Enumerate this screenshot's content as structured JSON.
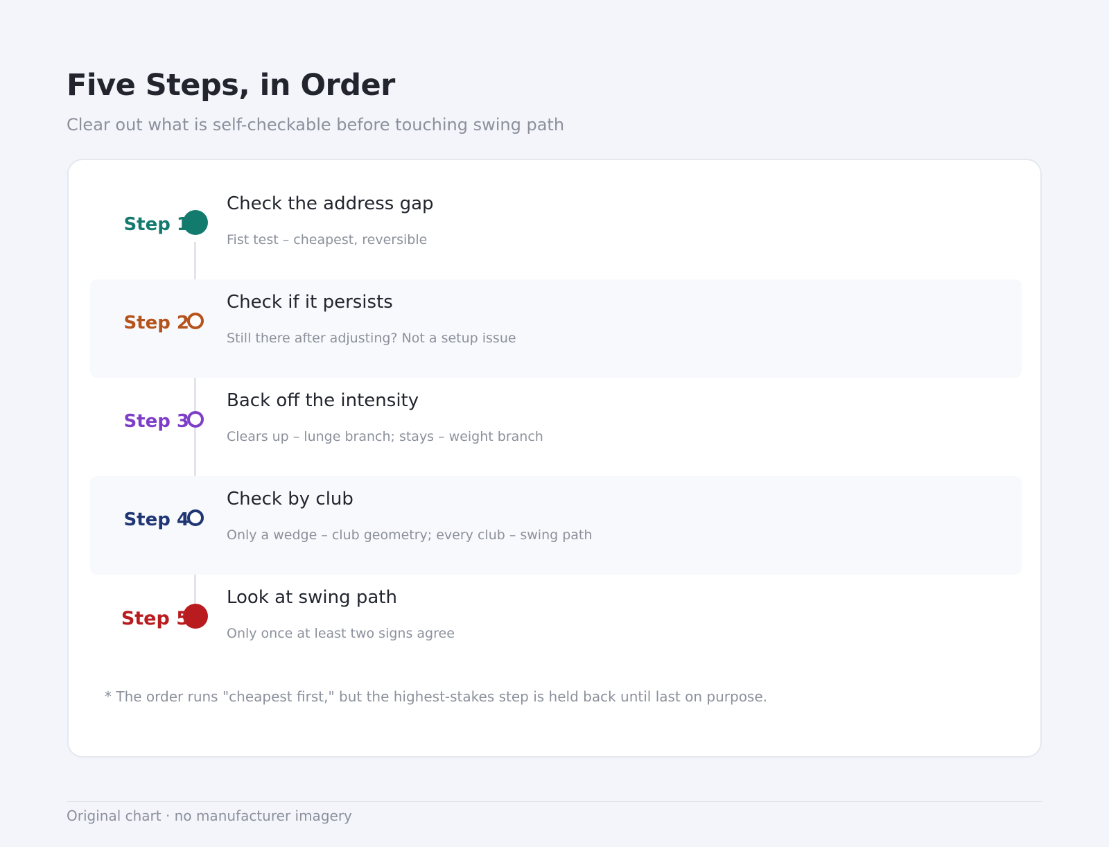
{
  "header": {
    "title": "Five Steps, in Order",
    "subtitle": "Clear out what is self-checkable before touching swing path"
  },
  "steps": [
    {
      "label": "Step 1",
      "title": "Check the address gap",
      "description": "Fist test – cheapest, reversible",
      "color": "#137a6e",
      "marker": "filled"
    },
    {
      "label": "Step 2",
      "title": "Check if it persists",
      "description": "Still there after adjusting? Not a setup issue",
      "color": "#b6531c",
      "marker": "ring"
    },
    {
      "label": "Step 3",
      "title": "Back off the intensity",
      "description": "Clears up – lunge branch; stays – weight branch",
      "color": "#7d3fc7",
      "marker": "ring"
    },
    {
      "label": "Step 4",
      "title": "Check by club",
      "description": "Only a wedge – club geometry; every club – swing path",
      "color": "#1f3673",
      "marker": "ring"
    },
    {
      "label": "Step 5",
      "title": "Look at swing path",
      "description": "Only once at least two signs agree",
      "color": "#b81c1f",
      "marker": "filled"
    }
  ],
  "note": "* The order runs \"cheapest first,\" but the highest-stakes step is held back until last on purpose.",
  "footer": "Original chart · no manufacturer imagery"
}
